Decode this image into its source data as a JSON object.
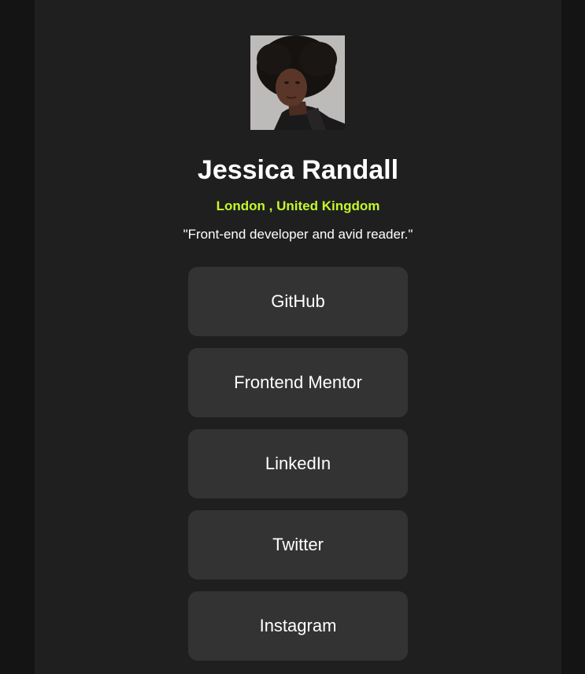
{
  "profile": {
    "name": "Jessica Randall",
    "location": "London , United Kingdom",
    "bio": "\"Front-end developer and avid reader.\""
  },
  "links": [
    {
      "label": "GitHub"
    },
    {
      "label": "Frontend Mentor"
    },
    {
      "label": "LinkedIn"
    },
    {
      "label": "Twitter"
    },
    {
      "label": "Instagram"
    }
  ],
  "colors": {
    "page_background": "#141414",
    "card_background": "#1f1f1f",
    "button_background": "#333333",
    "accent": "#c4f82a",
    "text": "#ffffff"
  }
}
